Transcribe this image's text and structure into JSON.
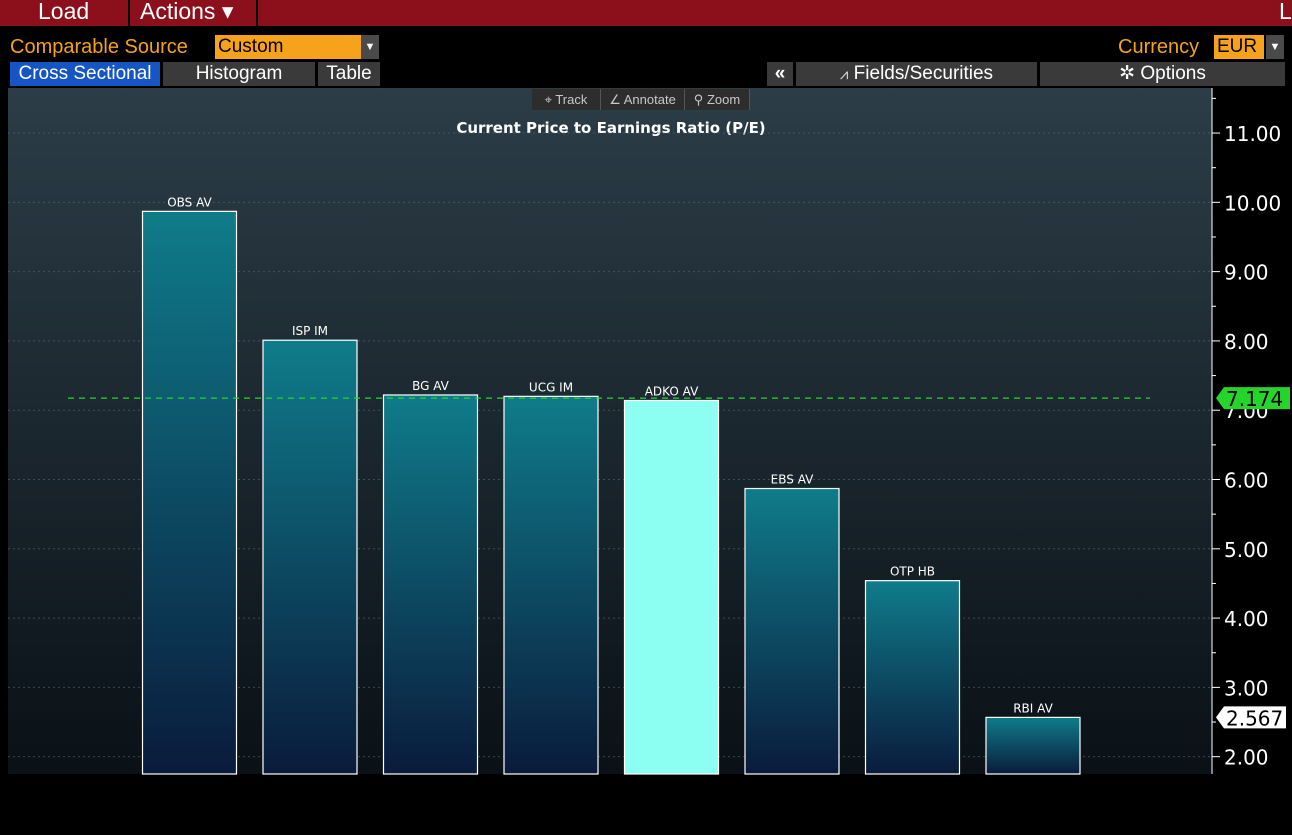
{
  "toolbar": {
    "load_label": "Load",
    "actions_label": "Actions ▾",
    "corner_glyph": "L"
  },
  "controls": {
    "comparable_source_label": "Comparable Source",
    "comparable_source_value": "Custom",
    "currency_label": "Currency",
    "currency_value": "EUR"
  },
  "tabs": [
    {
      "label": "Cross Sectional",
      "active": true
    },
    {
      "label": "Histogram",
      "active": false
    },
    {
      "label": "Table",
      "active": false
    }
  ],
  "right_tabs": {
    "collapse_label": "«",
    "fields_label": "Fields/Securities",
    "options_label": "Options"
  },
  "chart_tools": [
    {
      "icon": "track-icon",
      "label": "Track"
    },
    {
      "icon": "annotate-icon",
      "label": "Annotate"
    },
    {
      "icon": "zoom-icon",
      "label": "Zoom"
    }
  ],
  "colors": {
    "bar": "#0f7c8a",
    "highlight": "#8cfff2",
    "average_line": "#26d52b",
    "header": "#8b101c",
    "accent": "#f7a21b"
  },
  "chart_data": {
    "type": "bar",
    "title": "Current Price to Earnings Ratio (P/E)",
    "categories": [
      "OBS AV",
      "ISP IM",
      "BG AV",
      "UCG IM",
      "ADKO AV",
      "EBS AV",
      "OTP HB",
      "RBI AV"
    ],
    "values": [
      9.87,
      8.01,
      7.22,
      7.2,
      7.14,
      5.87,
      4.54,
      2.567
    ],
    "highlight_index": 4,
    "average": 7.174,
    "average_label": "7.174",
    "last_value_label": "2.567",
    "ylim": [
      1.75,
      11.65
    ],
    "yticks": [
      2,
      3,
      4,
      5,
      6,
      7,
      8,
      9,
      10,
      11
    ],
    "ytick_labels": [
      "2.00",
      "3.00",
      "4.00",
      "5.00",
      "6.00",
      "7.00",
      "8.00",
      "9.00",
      "10.00",
      "11.00"
    ],
    "y_axis_position": "right",
    "grid": true
  }
}
